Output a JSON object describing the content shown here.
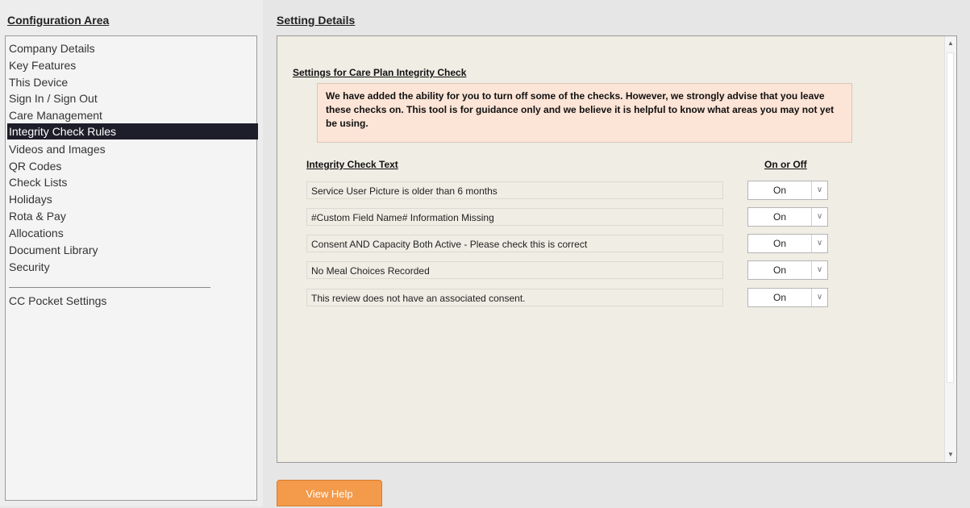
{
  "config_area": {
    "title": "Configuration Area",
    "items": [
      {
        "label": "Company Details"
      },
      {
        "label": "Key Features"
      },
      {
        "label": "This Device"
      },
      {
        "label": "Sign In / Sign Out"
      },
      {
        "label": "Care Management"
      },
      {
        "label": "Integrity Check Rules",
        "selected": true
      },
      {
        "label": "Videos and Images"
      },
      {
        "label": "QR Codes"
      },
      {
        "label": "Check Lists"
      },
      {
        "label": "Holidays"
      },
      {
        "label": "Rota & Pay"
      },
      {
        "label": "Allocations"
      },
      {
        "label": "Document Library"
      },
      {
        "label": "Security"
      }
    ],
    "extra_item": "CC Pocket Settings"
  },
  "setting_details": {
    "title": "Setting Details",
    "section_title": "Settings for Care Plan Integrity Check",
    "advice": "We have added the ability for you to turn off some of the checks.  However, we strongly advise that you leave these checks on.  This tool is for guidance only and we believe it is helpful to know what areas you may not yet be using.",
    "col_text": "Integrity Check Text",
    "col_toggle": "On or Off",
    "rules": [
      {
        "text": "Service User Picture is older than 6 months",
        "value": "On"
      },
      {
        "text": "#Custom Field Name# Information Missing",
        "value": "On"
      },
      {
        "text": "Consent AND Capacity Both Active - Please check this is correct",
        "value": "On"
      },
      {
        "text": "No Meal Choices Recorded",
        "value": "On"
      },
      {
        "text": "This review does not have an associated consent.",
        "value": "On"
      }
    ]
  },
  "footer": {
    "help_button": "View Help"
  },
  "colors": {
    "selected_bg": "#1e1e2a",
    "advice_bg": "#fce4d6",
    "help_button_bg": "#f39a4b",
    "panel_bg": "#efede4"
  }
}
